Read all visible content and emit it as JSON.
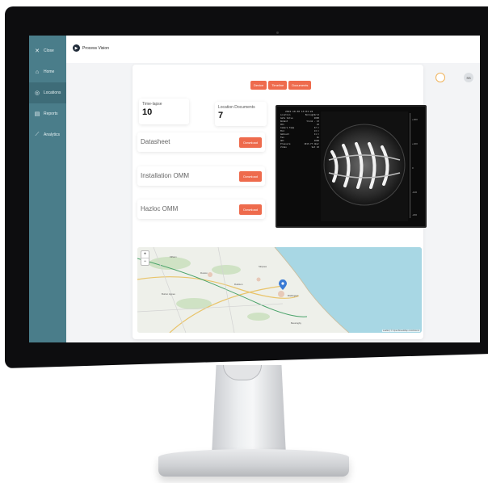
{
  "sidebar": {
    "items": [
      {
        "icon": "close-icon",
        "glyph": "✕",
        "label": "Close"
      },
      {
        "icon": "home-icon",
        "glyph": "⌂",
        "label": "Home"
      },
      {
        "icon": "location-pin-icon",
        "glyph": "◎",
        "label": "Locations"
      },
      {
        "icon": "reports-icon",
        "glyph": "▤",
        "label": "Reports"
      },
      {
        "icon": "analytics-icon",
        "glyph": "⟋",
        "label": "Analytics"
      }
    ],
    "active_index": 2
  },
  "header": {
    "app_name": "Process Vision",
    "avatar_initials": "SS"
  },
  "tabs": [
    "Device",
    "Timeline",
    "Documents"
  ],
  "stats": {
    "timelapse": {
      "label": "Time-lapse",
      "value": "10"
    },
    "location_documents": {
      "label": "Location Documents",
      "value": "7"
    }
  },
  "documents": [
    {
      "name": "Datasheet",
      "action": "Download"
    },
    {
      "name": "Installation OMM",
      "action": "Download"
    },
    {
      "name": "Hazloc OMM",
      "action": "Download"
    }
  ],
  "video": {
    "title": "2022-10-30 13:01:22",
    "info": [
      {
        "k": "Location",
        "v": "Boroughbrid"
      },
      {
        "k": "Gate Valve",
        "v": "2000"
      },
      {
        "k": "Rodent",
        "v": "trunk - 13"
      },
      {
        "k": "ID1",
        "v": "10"
      },
      {
        "k": "Camera Temp",
        "v": "37 C"
      },
      {
        "k": "Mid",
        "v": "13 C"
      },
      {
        "k": "Ambient",
        "v": "11 C"
      },
      {
        "k": "Fan",
        "v": "On"
      },
      {
        "k": "ADC",
        "v": "2000"
      },
      {
        "k": "Pressure",
        "v": "1013.77 mbar"
      },
      {
        "k": "Video",
        "v": "Set 10"
      }
    ],
    "scale": [
      "+200",
      "+100",
      "0",
      "-100",
      "-200"
    ]
  },
  "map": {
    "zoom_in": "+",
    "zoom_out": "−",
    "attribution": "Leaflet | © OpenStreetMap contributors",
    "place_labels": [
      "Ruston",
      "Rudston",
      "Burton Agnes",
      "Bessingby",
      "Bridlington",
      "Kilham",
      "Skipsea"
    ],
    "colors": {
      "sea": "#a8d7e4",
      "land": "#eef0ea",
      "forest": "#cfe2c4",
      "pin": "#3a7bd5"
    }
  },
  "colors": {
    "accent": "#ee6b4d",
    "sidebar": "#4a7d8a"
  }
}
